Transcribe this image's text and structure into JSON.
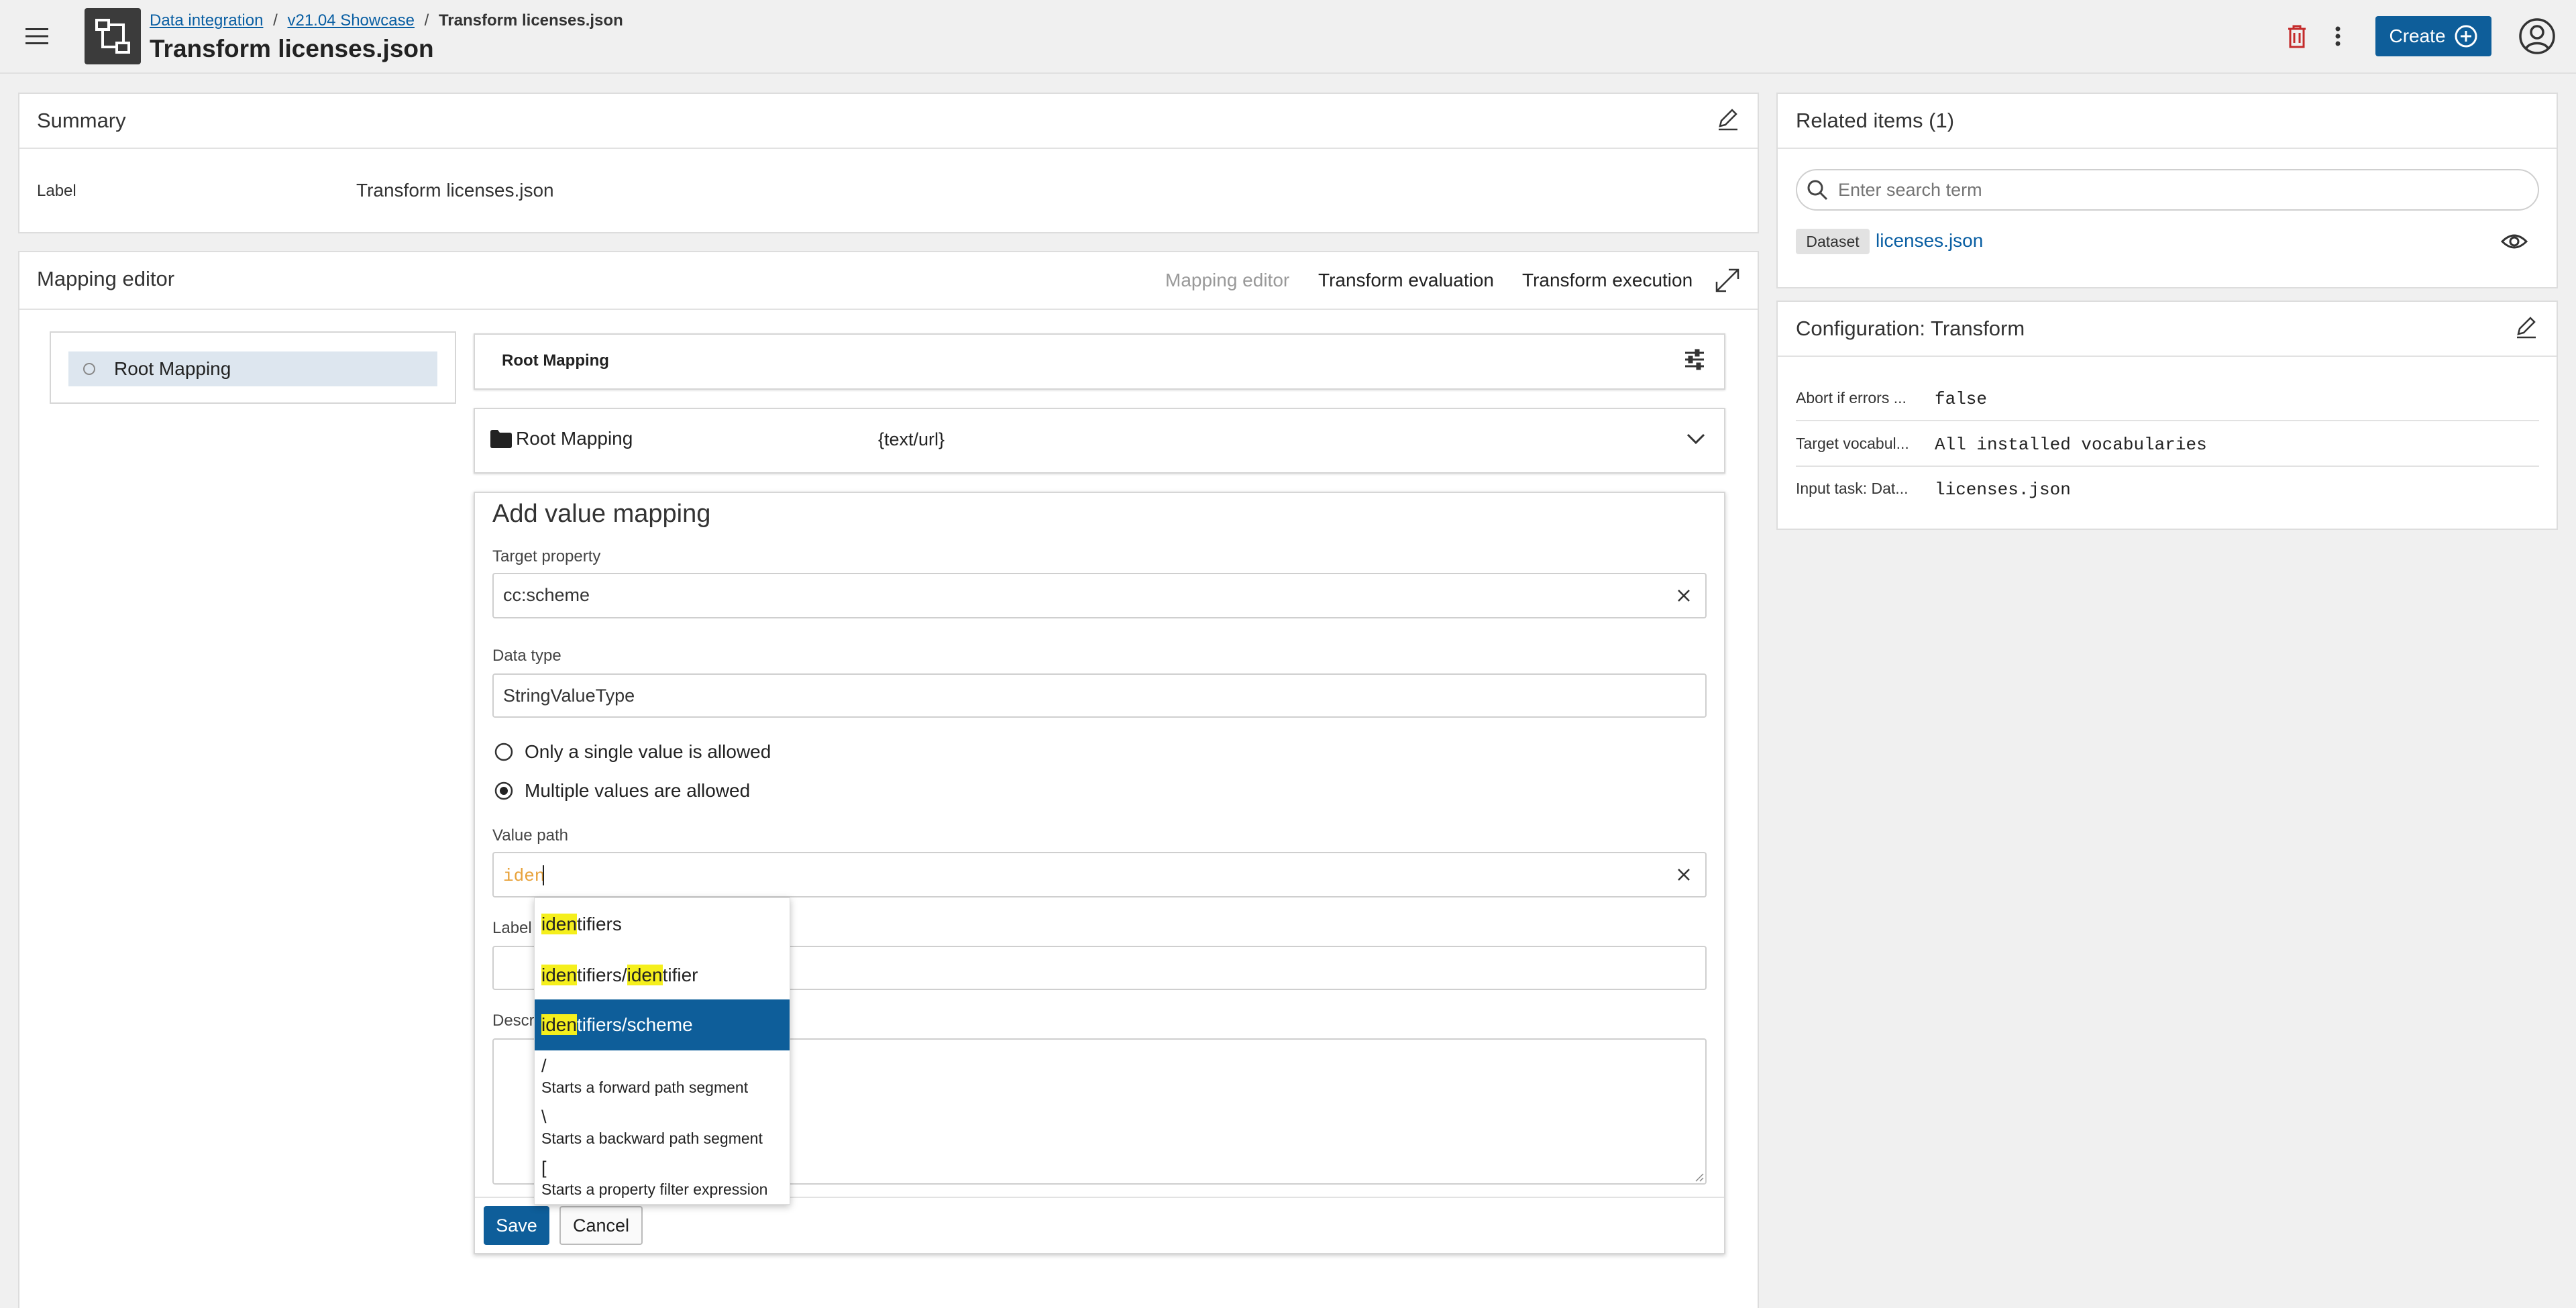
{
  "topbar": {
    "breadcrumbs": [
      "Data integration",
      "v21.04 Showcase",
      "Transform licenses.json"
    ],
    "separator": "/",
    "title": "Transform licenses.json",
    "create_label": "Create"
  },
  "summary": {
    "title": "Summary",
    "label_key": "Label",
    "label_value": "Transform licenses.json"
  },
  "mapping_editor": {
    "title": "Mapping editor",
    "tabs": [
      "Mapping editor",
      "Transform evaluation",
      "Transform execution"
    ],
    "tree_item": "Root Mapping",
    "header_title": "Root Mapping",
    "row_label": "Root Mapping",
    "row_type": "{text/url}"
  },
  "value_mapping": {
    "title": "Add value mapping",
    "target_property_label": "Target property",
    "target_property_value": "cc:scheme",
    "data_type_label": "Data type",
    "data_type_value": "StringValueType",
    "radio_single": "Only a single value is allowed",
    "radio_multiple": "Multiple values are allowed",
    "value_path_label": "Value path",
    "value_path_value": "iden",
    "label_label": "Label",
    "description_label": "Description",
    "save_label": "Save",
    "cancel_label": "Cancel"
  },
  "autocomplete": {
    "items": [
      {
        "match": "iden",
        "rest": "tifiers"
      },
      {
        "match": "iden",
        "mid": "tifiers/",
        "match2": "iden",
        "rest": "tifier"
      },
      {
        "match": "iden",
        "rest": "tifiers/scheme"
      }
    ],
    "ops": [
      {
        "symbol": "/",
        "desc": "Starts a forward path segment"
      },
      {
        "symbol": "\\",
        "desc": "Starts a backward path segment"
      },
      {
        "symbol": "[",
        "desc": "Starts a property filter expression"
      }
    ]
  },
  "related": {
    "title": "Related items (1)",
    "search_placeholder": "Enter search term",
    "badge": "Dataset",
    "item_label": "licenses.json"
  },
  "config": {
    "title": "Configuration: Transform",
    "rows": [
      {
        "key": "Abort if errors ...",
        "value": "false"
      },
      {
        "key": "Target vocabul...",
        "value": "All installed vocabularies"
      },
      {
        "key": "Input task: Dat...",
        "value": "licenses.json"
      }
    ]
  },
  "colors": {
    "primary": "#0e5e9a",
    "highlight": "#f5ef1c",
    "delete": "#c42b2b",
    "autocomplete_match": "#e8a23a"
  }
}
